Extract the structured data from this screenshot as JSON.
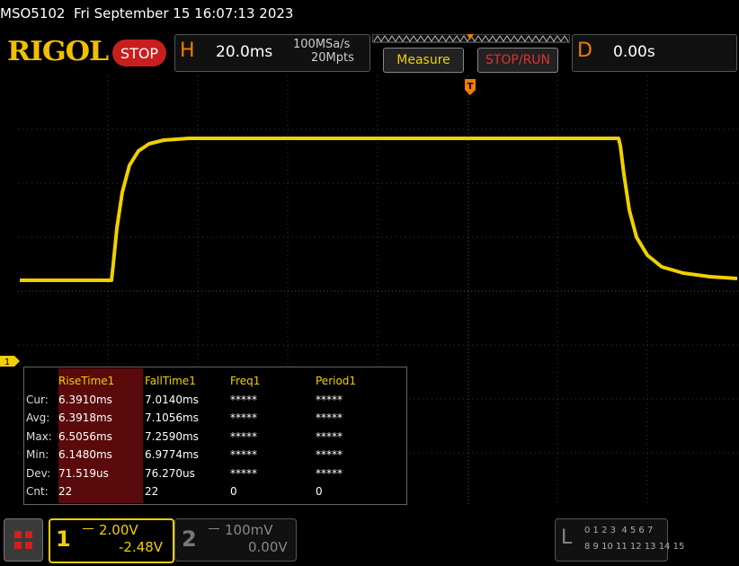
{
  "header": {
    "title": "MSO5102  Fri September 15 16:07:13 2023",
    "logo_text": "RIGOL",
    "run_state": "STOP"
  },
  "timebase": {
    "label": "H",
    "scale": "20.0ms",
    "sample_rate": "100MSa/s",
    "memory_depth": "20Mpts"
  },
  "toolbar": {
    "measure_label": "Measure",
    "stoprun_label": "STOP/RUN"
  },
  "delay": {
    "label": "D",
    "value": "0.00s"
  },
  "trigger": {
    "marker_label": "T"
  },
  "channel_marker": {
    "label": "1"
  },
  "measurements": {
    "row_labels": [
      "Cur:",
      "Avg:",
      "Max:",
      "Min:",
      "Dev:",
      "Cnt:"
    ],
    "columns": [
      {
        "header": "RiseTime1",
        "values": [
          "6.3910ms",
          "6.3918ms",
          "6.5056ms",
          "6.1480ms",
          "71.519us",
          "22"
        ]
      },
      {
        "header": "FallTime1",
        "values": [
          "7.0140ms",
          "7.1056ms",
          "7.2590ms",
          "6.9774ms",
          "76.270us",
          "22"
        ]
      },
      {
        "header": "Freq1",
        "values": [
          "*****",
          "*****",
          "*****",
          "*****",
          "*****",
          "0"
        ]
      },
      {
        "header": "Period1",
        "values": [
          "*****",
          "*****",
          "*****",
          "*****",
          "*****",
          "0"
        ]
      }
    ]
  },
  "channels": {
    "ch1": {
      "number": "1",
      "scale": "2.00V",
      "offset": "-2.48V",
      "active": true
    },
    "ch2": {
      "number": "2",
      "scale": "100mV",
      "offset": "0.00V",
      "active": false
    }
  },
  "logic_analyzer": {
    "label": "L",
    "row1": "0 1 2 3  4 5 6 7",
    "row2": "8 9 10 11 12 13 14 15"
  },
  "colors": {
    "ch1": "#f0d000",
    "accent": "#f07c00",
    "stop": "#c81e1e"
  }
}
